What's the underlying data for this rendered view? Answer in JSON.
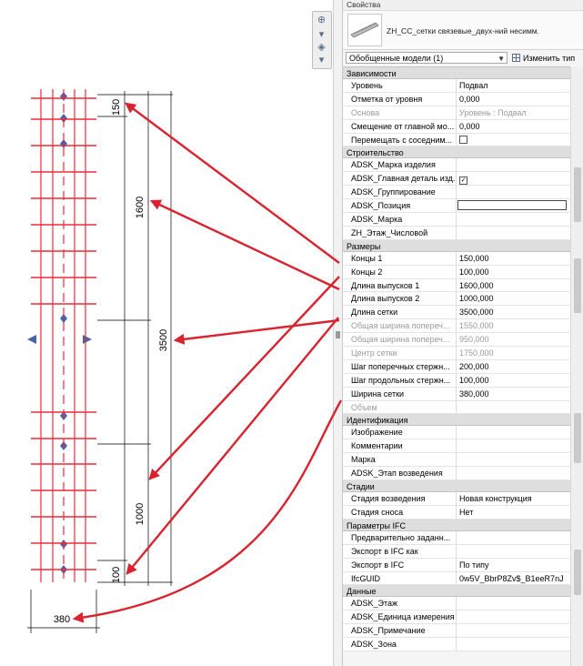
{
  "drawing": {
    "dim_labels": [
      "150",
      "1600",
      "3500",
      "1000",
      "100",
      "380"
    ]
  },
  "panel": {
    "title": "Свойства",
    "type_name": "ZH_CC_сетки связевые_двух-ний несимм.",
    "selector": "Обобщенные модели (1)",
    "edit_type": "Изменить тип"
  },
  "groups": [
    {
      "name": "Зависимости",
      "rows": [
        {
          "label": "Уровень",
          "value": "Подвал"
        },
        {
          "label": "Отметка от уровня",
          "value": "0,000"
        },
        {
          "label": "Основа",
          "value": "Уровень : Подвал",
          "ro": true
        },
        {
          "label": "Смещение от главной мо...",
          "value": "0,000"
        },
        {
          "label": "Перемещать с соседним...",
          "check": ""
        }
      ]
    },
    {
      "name": "Строительство",
      "rows": [
        {
          "label": "ADSK_Марка изделия",
          "value": ""
        },
        {
          "label": "ADSK_Главная деталь изд...",
          "check": "✓"
        },
        {
          "label": "ADSK_Группирование",
          "value": ""
        },
        {
          "label": "ADSK_Позиция",
          "value": "",
          "edit": true
        },
        {
          "label": "ADSK_Марка",
          "value": ""
        },
        {
          "label": "ZH_Этаж_Числовой",
          "value": ""
        }
      ]
    },
    {
      "name": "Размеры",
      "rows": [
        {
          "label": "Концы 1",
          "value": "150,000"
        },
        {
          "label": "Концы 2",
          "value": "100,000"
        },
        {
          "label": "Длина выпусков 1",
          "value": "1600,000"
        },
        {
          "label": "Длина выпусков 2",
          "value": "1000,000"
        },
        {
          "label": "Длина сетки",
          "value": "3500,000"
        },
        {
          "label": "Общая ширина попереч...",
          "value": "1550,000",
          "ro": true
        },
        {
          "label": "Общая ширина попереч...",
          "value": "950,000",
          "ro": true
        },
        {
          "label": "Центр сетки",
          "value": "1750,000",
          "ro": true
        },
        {
          "label": "Шаг поперечных стержн...",
          "value": "200,000"
        },
        {
          "label": "Шаг продольных стержн...",
          "value": "100,000"
        },
        {
          "label": "Ширина сетки",
          "value": "380,000"
        },
        {
          "label": "Объем",
          "value": "",
          "ro": true
        }
      ]
    },
    {
      "name": "Идентификация",
      "rows": [
        {
          "label": "Изображение",
          "value": ""
        },
        {
          "label": "Комментарии",
          "value": ""
        },
        {
          "label": "Марка",
          "value": ""
        },
        {
          "label": "ADSK_Этап возведения",
          "value": ""
        }
      ]
    },
    {
      "name": "Стадии",
      "rows": [
        {
          "label": "Стадия возведения",
          "value": "Новая конструкция"
        },
        {
          "label": "Стадия сноса",
          "value": "Нет"
        }
      ]
    },
    {
      "name": "Параметры IFC",
      "rows": [
        {
          "label": "Предварительно заданн...",
          "value": ""
        },
        {
          "label": "Экспорт в IFC как",
          "value": ""
        },
        {
          "label": "Экспорт в IFC",
          "value": "По типу"
        },
        {
          "label": "IfcGUID",
          "value": "0w5V_BbrP8Zv$_B1eeR7nJ"
        }
      ]
    },
    {
      "name": "Данные",
      "rows": [
        {
          "label": "ADSK_Этаж",
          "value": ""
        },
        {
          "label": "ADSK_Единица измерения",
          "value": ""
        },
        {
          "label": "ADSK_Примечание",
          "value": ""
        },
        {
          "label": "ADSK_Зона",
          "value": ""
        }
      ]
    }
  ],
  "colors": {
    "rebar": "#ee2b3b",
    "arrow": "#d9232e",
    "grip": "#4a63a8"
  }
}
